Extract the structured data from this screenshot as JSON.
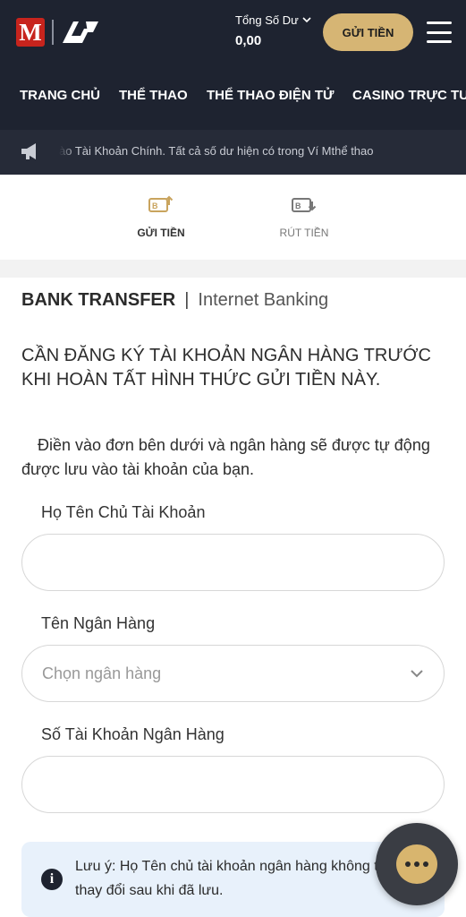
{
  "header": {
    "logo_text": "M",
    "balance_label": "Tổng Số Dư",
    "balance_value": "0,00",
    "deposit_button": "GỬI TIỀN"
  },
  "nav": {
    "items": [
      "TRANG CHỦ",
      "THỂ THAO",
      "THỂ THAO ĐIỆN TỬ",
      "CASINO TRỰC TU"
    ]
  },
  "announcement": {
    "text": "ào Tài Khoản Chính. Tất cả số dư hiện có trong Ví Mthể thao"
  },
  "tabs": {
    "deposit": "GỬI TIỀN",
    "withdraw": "RÚT TIỀN"
  },
  "method": {
    "primary": "BANK TRANSFER",
    "separator": "|",
    "secondary": "Internet Banking"
  },
  "notice": {
    "title": "CẦN ĐĂNG KÝ TÀI KHOẢN NGÂN HÀNG TRƯỚC KHI HOÀN TẤT HÌNH THỨC GỬI TIỀN NÀY.",
    "description": "Điền vào đơn bên dưới và ngân hàng sẽ được tự động được lưu vào tài khoản của bạn."
  },
  "form": {
    "account_holder_label": "Họ Tên Chủ Tài Khoản",
    "account_holder_value": "",
    "bank_name_label": "Tên Ngân Hàng",
    "bank_name_placeholder": "Chọn ngân hàng",
    "account_number_label": "Số Tài Khoản Ngân Hàng",
    "account_number_value": ""
  },
  "note": {
    "text": "Lưu ý: Họ Tên chủ tài khoản ngân hàng không thể thay đổi sau khi đã lưu."
  },
  "colors": {
    "header_bg": "#1e2330",
    "accent_gold": "#d6b574",
    "note_bg": "#e8f1fb"
  }
}
